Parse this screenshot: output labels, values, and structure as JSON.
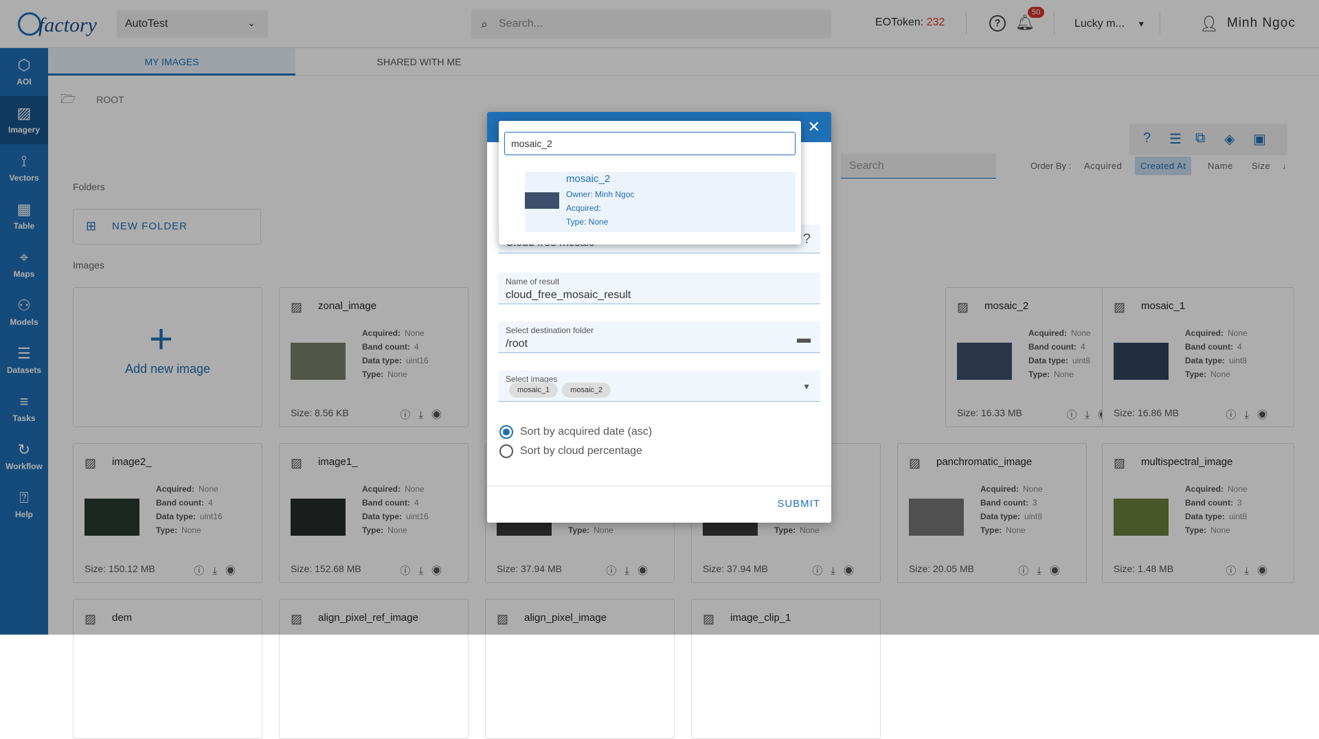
{
  "header": {
    "logo_text": "factory",
    "project": "AutoTest",
    "search_placeholder": "Search...",
    "token_label": "EOToken:",
    "token_value": "232",
    "notification_count": "50",
    "user_short": "Lucky m...",
    "user_name": "Minh Ngọc"
  },
  "sidebar": {
    "items": [
      {
        "label": "AOI",
        "icon": "aoi-icon"
      },
      {
        "label": "Imagery",
        "icon": "image-icon"
      },
      {
        "label": "Vectors",
        "icon": "vector-icon"
      },
      {
        "label": "Table",
        "icon": "table-icon"
      },
      {
        "label": "Maps",
        "icon": "map-icon"
      },
      {
        "label": "Models",
        "icon": "model-icon"
      },
      {
        "label": "Datasets",
        "icon": "database-icon"
      },
      {
        "label": "Tasks",
        "icon": "tasks-icon"
      },
      {
        "label": "Workflow",
        "icon": "workflow-icon"
      },
      {
        "label": "Help",
        "icon": "help-icon"
      }
    ],
    "active": "Imagery"
  },
  "tabs": {
    "my_images": "MY IMAGES",
    "shared": "SHARED WITH ME"
  },
  "breadcrumb": "ROOT",
  "toolbar": {
    "search_placeholder": "Search",
    "order_by_label": "Order By :",
    "order_options": [
      "Acquired",
      "Created At",
      "Name",
      "Size"
    ],
    "order_selected": "Created At"
  },
  "sections": {
    "folders": "Folders",
    "images": "Images",
    "new_folder": "NEW FOLDER",
    "add_image": "Add new image"
  },
  "labels": {
    "acquired": "Acquired:",
    "band_count": "Band count:",
    "data_type": "Data type:",
    "type": "Type:"
  },
  "images": [
    {
      "name": "zonal_image",
      "acquired": "None",
      "band_count": "4",
      "data_type": "uint16",
      "type": "None",
      "size": "Size: 8.56 KB",
      "thumb": "#7a7f6a"
    },
    {
      "name": "mosaic_2",
      "acquired": "None",
      "band_count": "4",
      "data_type": "uint8",
      "type": "None",
      "size": "Size: 16.33 MB",
      "thumb": "#3d4f6a"
    },
    {
      "name": "mosaic_1",
      "acquired": "None",
      "band_count": "4",
      "data_type": "uint8",
      "type": "None",
      "size": "Size: 16.86 MB",
      "thumb": "#31455e"
    },
    {
      "name": "image2_",
      "acquired": "None",
      "band_count": "4",
      "data_type": "uint16",
      "type": "None",
      "size": "Size: 150.12 MB",
      "thumb": "#2a3a33"
    },
    {
      "name": "image1_",
      "acquired": "None",
      "band_count": "4",
      "data_type": "uint16",
      "type": "None",
      "size": "Size: 152.68 MB",
      "thumb": "#262b2a"
    },
    {
      "name": "",
      "acquired": "",
      "band_count": "",
      "data_type": "",
      "type": "None",
      "size": "Size: 37.94 MB",
      "thumb": "#3a3a3a"
    },
    {
      "name": "",
      "acquired": "",
      "band_count": "",
      "data_type": "",
      "type": "None",
      "size": "Size: 37.94 MB",
      "thumb": "#3a3a3a"
    },
    {
      "name": "panchromatic_image",
      "acquired": "None",
      "band_count": "3",
      "data_type": "uint8",
      "type": "None",
      "size": "Size: 20.05 MB",
      "thumb": "#777777"
    },
    {
      "name": "multispectral_image",
      "acquired": "None",
      "band_count": "3",
      "data_type": "uint8",
      "type": "None",
      "size": "Size: 1.48 MB",
      "thumb": "#6a7f3e"
    },
    {
      "name": "dem"
    },
    {
      "name": "align_pixel_ref_image"
    },
    {
      "name": "align_pixel_image"
    },
    {
      "name": "image_clip_1"
    }
  ],
  "dialog": {
    "algorithm": "Cloud free mosaic",
    "result_label": "Name of result",
    "result_value": "cloud_free_mosaic_result",
    "folder_label": "Select destination folder",
    "folder_value": "/root",
    "images_label": "Select images",
    "selected_images": [
      "mosaic_1",
      "mosaic_2"
    ],
    "sort_options": [
      "Sort by acquired date (asc)",
      "Sort by cloud percentage"
    ],
    "sort_selected": 0,
    "submit": "SUBMIT"
  },
  "dropdown": {
    "query": "mosaic_2",
    "result": {
      "title": "mosaic_2",
      "owner": "Owner: Minh Ngọc",
      "acquired": "Acquired:",
      "type": "Type: None"
    }
  }
}
